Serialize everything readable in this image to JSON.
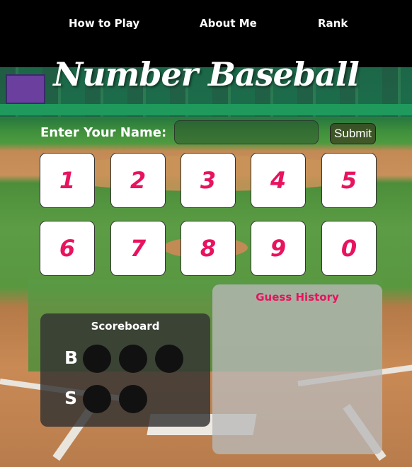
{
  "nav": {
    "items": [
      {
        "label": "How to Play"
      },
      {
        "label": "About Me"
      },
      {
        "label": "Rank"
      }
    ]
  },
  "title": "Number Baseball",
  "name_form": {
    "label": "Enter Your Name:",
    "input_value": "",
    "submit_label": "Submit"
  },
  "number_pad": [
    "1",
    "2",
    "3",
    "4",
    "5",
    "6",
    "7",
    "8",
    "9",
    "0"
  ],
  "scoreboard": {
    "title": "Scoreboard",
    "balls_label": "B",
    "strikes_label": "S",
    "balls_count": 3,
    "strikes_count": 2
  },
  "history": {
    "title": "Guess History"
  },
  "colors": {
    "accent": "#e8135f",
    "nav_bg": "#000000"
  }
}
